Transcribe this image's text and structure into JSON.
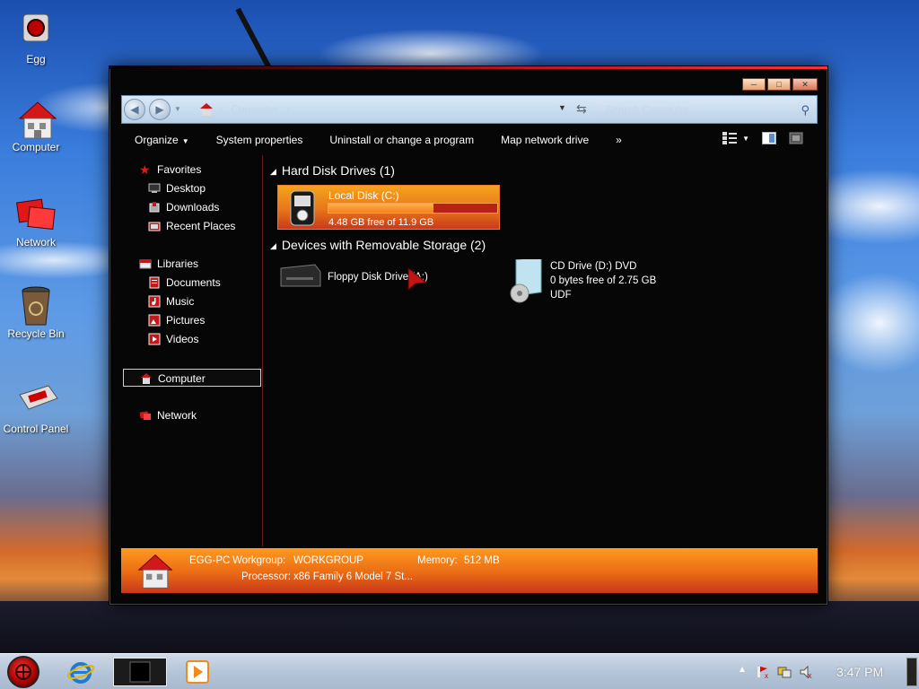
{
  "desktop": {
    "icons": [
      {
        "label": "Egg"
      },
      {
        "label": "Computer"
      },
      {
        "label": "Network"
      },
      {
        "label": "Recycle Bin"
      },
      {
        "label": "Control Panel"
      }
    ]
  },
  "window": {
    "address": {
      "breadcrumb": "Computer",
      "separator": "›"
    },
    "search_placeholder": "Search Computer",
    "toolbar": {
      "organize": "Organize",
      "system_properties": "System properties",
      "uninstall": "Uninstall or change a program",
      "map_drive": "Map network drive",
      "more": "»"
    },
    "nav": {
      "favorites": "Favorites",
      "desktop": "Desktop",
      "downloads": "Downloads",
      "recent_places": "Recent Places",
      "libraries": "Libraries",
      "documents": "Documents",
      "music": "Music",
      "pictures": "Pictures",
      "videos": "Videos",
      "computer": "Computer",
      "network": "Network"
    },
    "groups": {
      "hdd": "Hard Disk Drives (1)",
      "removable": "Devices with Removable Storage (2)"
    },
    "local_disk": {
      "name": "Local Disk (C:)",
      "free_text": "4.48 GB free of 11.9 GB",
      "used_fraction": 0.62
    },
    "floppy": {
      "name": "Floppy Disk Drive (A:)"
    },
    "cd": {
      "name": "CD Drive (D:) DVD",
      "free_text": "0 bytes free of 2.75 GB",
      "fs": "UDF"
    },
    "details": {
      "pc_name": "EGG-PC",
      "workgroup_label": "Workgroup:",
      "workgroup": "WORKGROUP",
      "memory_label": "Memory:",
      "memory": "512 MB",
      "processor_label": "Processor:",
      "processor": "x86 Family 6 Model 7 St..."
    }
  },
  "taskbar": {
    "clock": "3:47 PM"
  },
  "colors": {
    "accent": "#e8761a",
    "window_bg": "#060606",
    "taskbar": "#b5c5d8"
  }
}
